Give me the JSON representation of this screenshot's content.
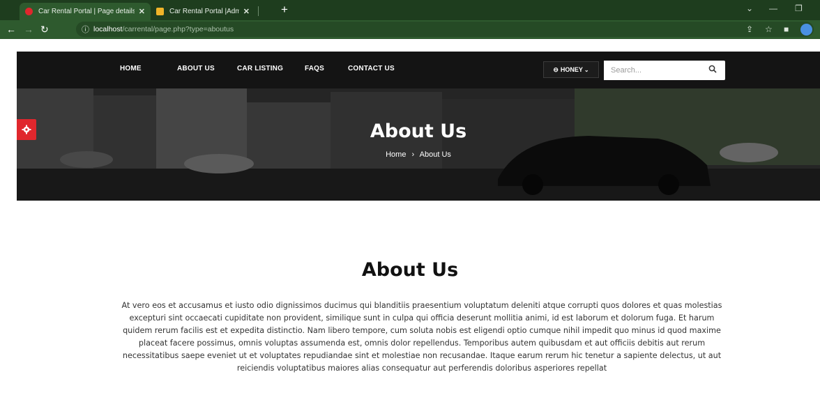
{
  "browser": {
    "tabs": [
      {
        "title": "Car Rental Portal | Page details",
        "active": true,
        "favicon_color": "#e0272d"
      },
      {
        "title": "Car Rental Portal |Admin Manag",
        "active": false,
        "favicon_color": "#f0b429"
      }
    ],
    "new_tab": "+",
    "url_host": "localhost",
    "url_path": "/carrental/page.php?type=aboutus"
  },
  "nav": {
    "items": [
      "HOME",
      "ABOUT US",
      "CAR LISTING",
      "FAQS",
      "CONTACT US"
    ],
    "user_label": "HONEY",
    "search_placeholder": "Search..."
  },
  "hero": {
    "title": "About Us",
    "breadcrumb": [
      "Home",
      "About Us"
    ]
  },
  "content": {
    "title": "About Us",
    "paragraph": "At vero eos et accusamus et iusto odio dignissimos ducimus qui blanditiis praesentium voluptatum deleniti atque corrupti quos dolores et quas molestias excepturi sint occaecati cupiditate non provident, similique sunt in culpa qui officia deserunt mollitia animi, id est laborum et dolorum fuga. Et harum quidem rerum facilis est et expedita distinctio. Nam libero tempore, cum soluta nobis est eligendi optio cumque nihil impedit quo minus id quod maxime placeat facere possimus, omnis voluptas assumenda est, omnis dolor repellendus. Temporibus autem quibusdam et aut officiis debitis aut rerum necessitatibus saepe eveniet ut et voluptates repudiandae sint et molestiae non recusandae. Itaque earum rerum hic tenetur a sapiente delectus, ut aut reiciendis voluptatibus maiores alias consequatur aut perferendis doloribus asperiores repellat"
  },
  "colors": {
    "accent": "#e0272d",
    "navbar": "#141414",
    "browser_chrome": "#2e5a2e"
  }
}
